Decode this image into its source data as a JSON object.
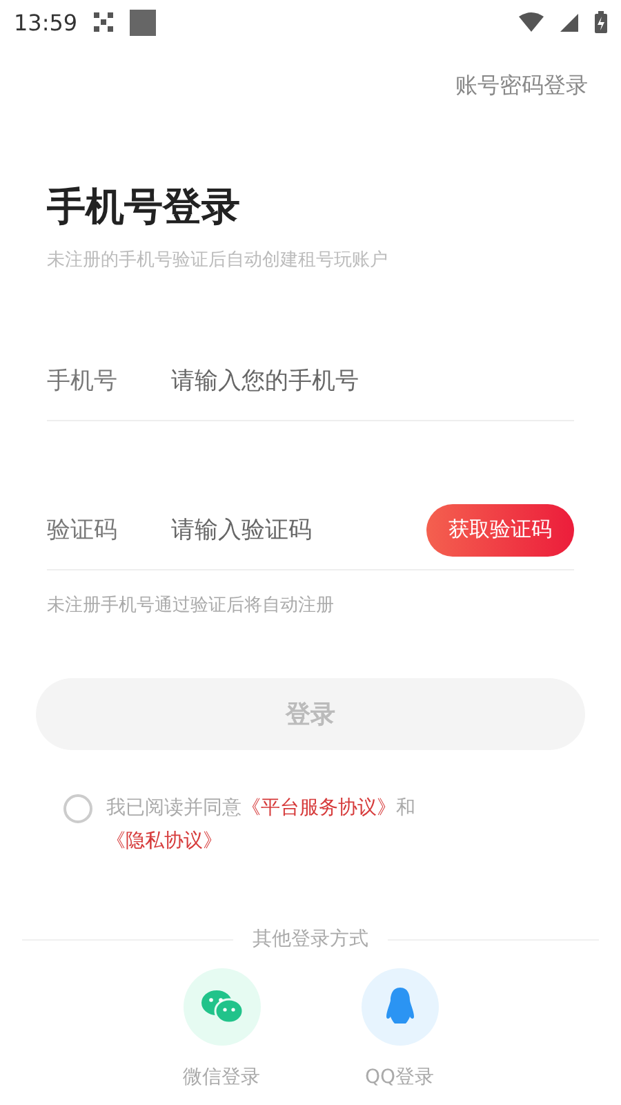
{
  "status_bar": {
    "time": "13:59"
  },
  "account_login_link": "账号密码登录",
  "title": "手机号登录",
  "subtitle": "未注册的手机号验证后自动创建租号玩账户",
  "fields": [
    {
      "label": "手机号",
      "placeholder": "请输入您的手机号"
    },
    {
      "label": "验证码",
      "placeholder": "请输入验证码",
      "action": "获取验证码"
    }
  ],
  "hint": "未注册手机号通过验证后将自动注册",
  "login_button": {
    "label": "登录",
    "disabled": true
  },
  "agreement": {
    "checked": false,
    "text": "我已阅读并同意",
    "link_1": "《平台服务协议》",
    "conjunction": "和",
    "link_2": "《隐私协议》"
  },
  "other_login": {
    "title": "其他登录方式",
    "options": [
      {
        "kind": "wechat",
        "label": "微信登录"
      },
      {
        "kind": "qq",
        "label": "QQ登录"
      }
    ]
  }
}
